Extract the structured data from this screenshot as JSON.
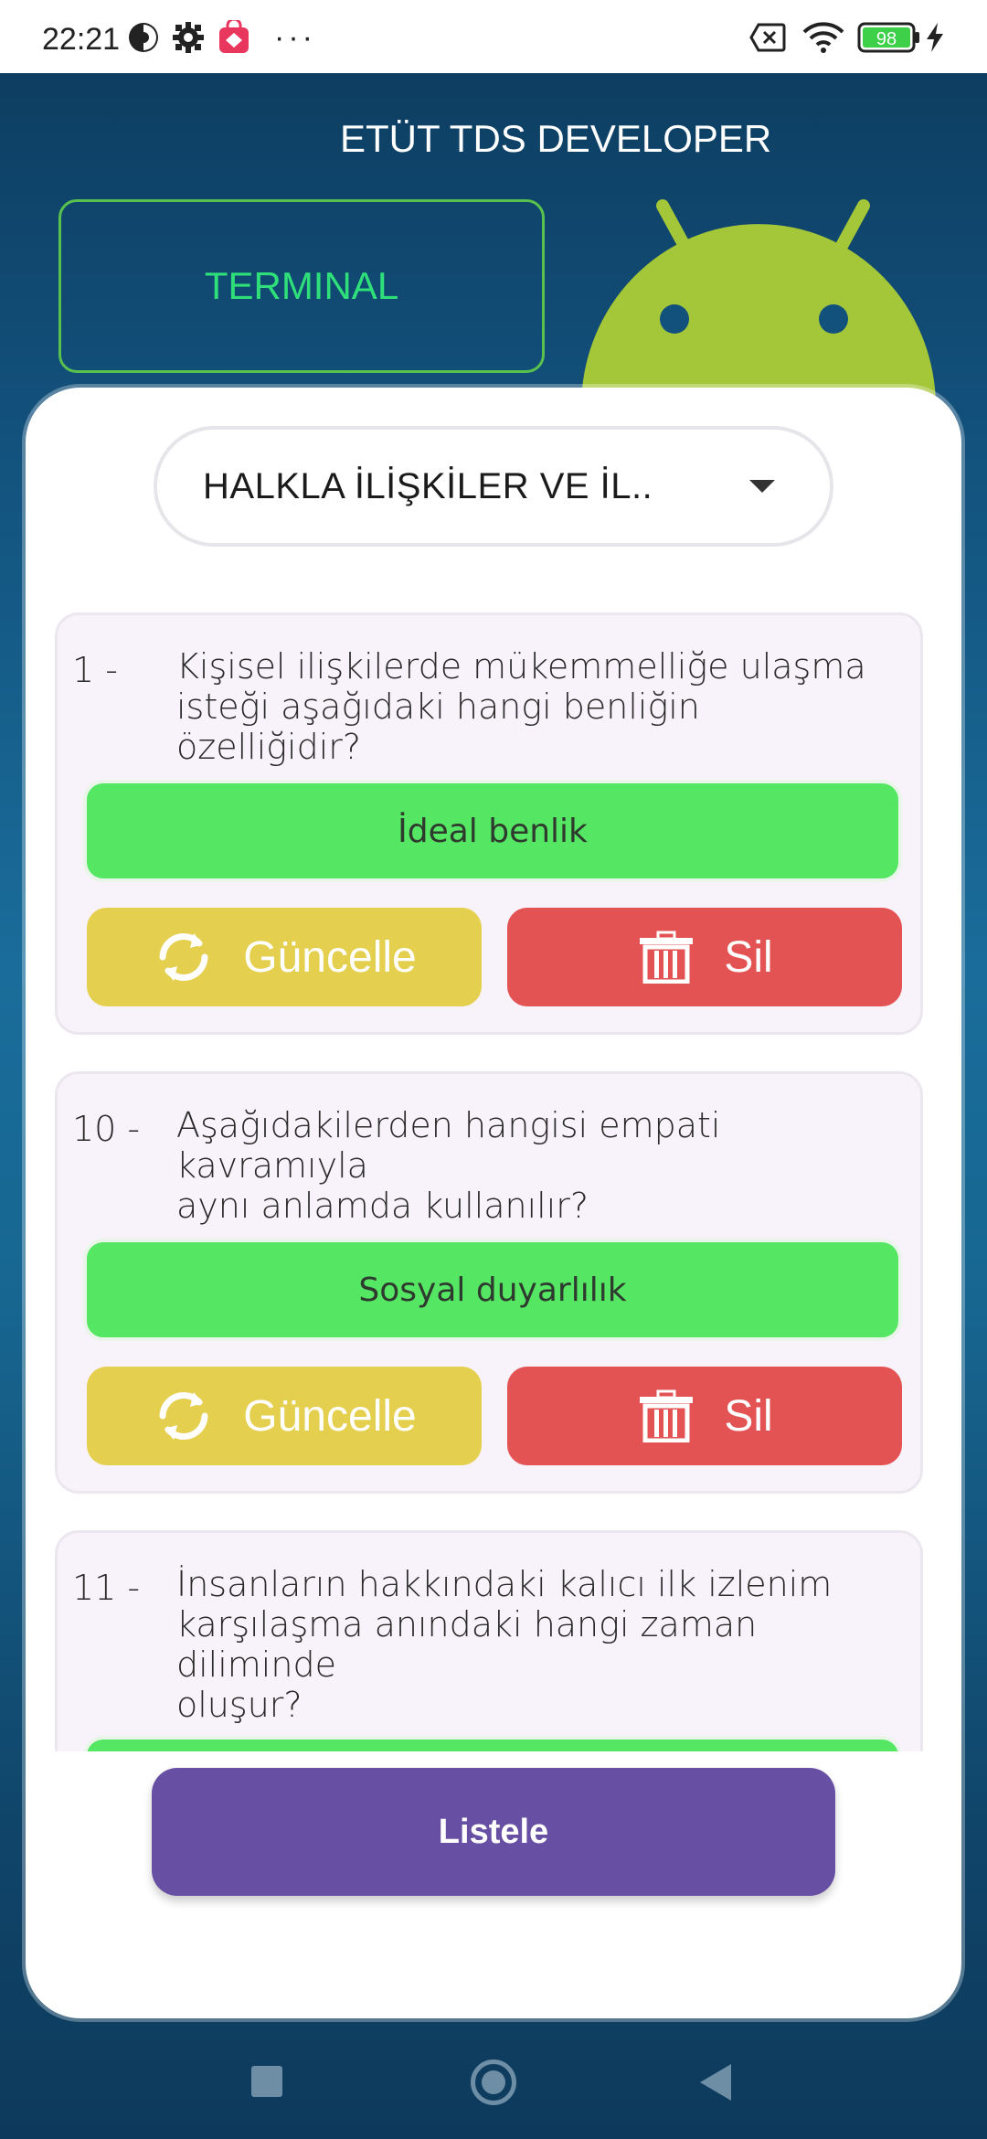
{
  "status_bar": {
    "time": "22:21",
    "battery": "98"
  },
  "app": {
    "title": "ETÜT TDS DEVELOPER",
    "terminal_label": "TERMINAL"
  },
  "dropdown": {
    "value": "HALKLA İLİŞKİLER VE İL.."
  },
  "questions": [
    {
      "number": "1 -",
      "text": "Kişisel ilişkilerde mükemmelliğe ulaşma\nisteği aşağıdaki hangi benliğin\nözelliğidir?",
      "answer": "İdeal benlik"
    },
    {
      "number": "10 -",
      "text": "Aşağıdakilerden hangisi empati\nkavramıyla\naynı anlamda kullanılır?",
      "answer": "Sosyal duyarlılık"
    },
    {
      "number": "11 -",
      "text": "İnsanların hakkındaki kalıcı ilk izlenim\nkarşılaşma anındaki hangi zaman\ndiliminde\noluşur?",
      "answer": ""
    }
  ],
  "actions": {
    "update_label": "Güncelle",
    "delete_label": "Sil",
    "list_label": "Listele"
  },
  "colors": {
    "answer_green": "#55e663",
    "update_yellow": "#e5cf4f",
    "delete_red": "#e45353",
    "list_purple": "#6750a4",
    "android_green": "#a4c639"
  }
}
